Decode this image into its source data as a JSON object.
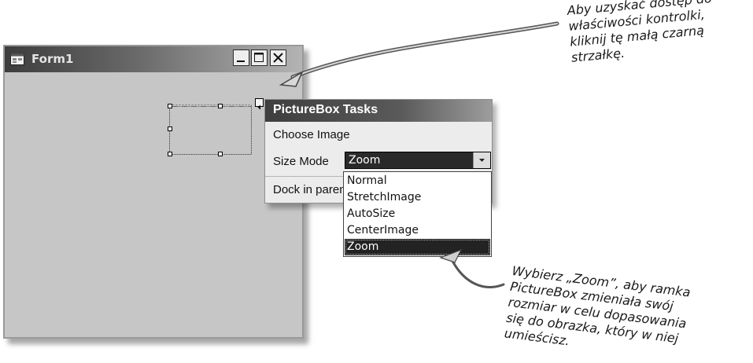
{
  "form": {
    "title": "Form1",
    "icon": "form-app-icon",
    "minimize_icon": "minimize-icon",
    "maximize_icon": "maximize-icon",
    "close_icon": "close-icon"
  },
  "tasks_panel": {
    "title": "PictureBox Tasks",
    "choose_image": "Choose Image",
    "size_mode_label": "Size Mode",
    "size_mode_value": "Zoom",
    "dock_label": "Dock in parent container"
  },
  "dropdown": {
    "options": [
      "Normal",
      "StretchImage",
      "AutoSize",
      "CenterImage",
      "Zoom"
    ],
    "selected": "Zoom"
  },
  "annotations": {
    "top": [
      "Aby uzyskać dostęp do",
      "właściwości kontrolki,",
      "kliknij tę małą czarną",
      "strzałkę."
    ],
    "bottom": [
      "Wybierz „Zoom”, aby ramka",
      "PictureBox zmieniała swój",
      "rozmiar w celu dopasowania",
      "się do obrazka, który w niej",
      "umieścisz."
    ]
  },
  "colors": {
    "titlebar_dark": "#3d3d3d",
    "form_background": "#c6c6c6",
    "selected_item": "#232323"
  }
}
